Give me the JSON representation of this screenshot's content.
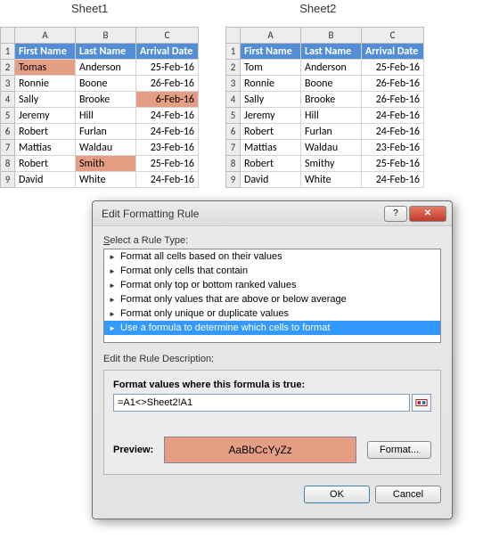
{
  "sheets": {
    "s1": {
      "label": "Sheet1"
    },
    "s2": {
      "label": "Sheet2"
    }
  },
  "cols": {
    "A": "A",
    "B": "B",
    "C": "C"
  },
  "hdr": {
    "fn": "First Name",
    "ln": "Last Name",
    "ad": "Arrival Date"
  },
  "d1": [
    {
      "n": "2",
      "fn": "Tomas",
      "ln": "Anderson",
      "ad": "25-Feb-16"
    },
    {
      "n": "3",
      "fn": "Ronnie",
      "ln": "Boone",
      "ad": "26-Feb-16"
    },
    {
      "n": "4",
      "fn": "Sally",
      "ln": "Brooke",
      "ad": "6-Feb-16"
    },
    {
      "n": "5",
      "fn": "Jeremy",
      "ln": "Hill",
      "ad": "24-Feb-16"
    },
    {
      "n": "6",
      "fn": "Robert",
      "ln": "Furlan",
      "ad": "24-Feb-16"
    },
    {
      "n": "7",
      "fn": "Mattias",
      "ln": "Waldau",
      "ad": "23-Feb-16"
    },
    {
      "n": "8",
      "fn": "Robert",
      "ln": "Smith",
      "ad": "25-Feb-16"
    },
    {
      "n": "9",
      "fn": "David",
      "ln": "White",
      "ad": "24-Feb-16"
    }
  ],
  "d2": [
    {
      "n": "2",
      "fn": "Tom",
      "ln": "Anderson",
      "ad": "25-Feb-16"
    },
    {
      "n": "3",
      "fn": "Ronnie",
      "ln": "Boone",
      "ad": "26-Feb-16"
    },
    {
      "n": "4",
      "fn": "Sally",
      "ln": "Brooke",
      "ad": "26-Feb-16"
    },
    {
      "n": "5",
      "fn": "Jeremy",
      "ln": "Hill",
      "ad": "24-Feb-16"
    },
    {
      "n": "6",
      "fn": "Robert",
      "ln": "Furlan",
      "ad": "24-Feb-16"
    },
    {
      "n": "7",
      "fn": "Mattias",
      "ln": "Waldau",
      "ad": "23-Feb-16"
    },
    {
      "n": "8",
      "fn": "Robert",
      "ln": "Smithy",
      "ad": "25-Feb-16"
    },
    {
      "n": "9",
      "fn": "David",
      "ln": "White",
      "ad": "24-Feb-16"
    }
  ],
  "row1": "1",
  "dialog": {
    "title": "Edit Formatting Rule",
    "select_label_pre": "S",
    "select_label_rest": "elect a Rule Type:",
    "rules": {
      "r0": "Format all cells based on their values",
      "r1": "Format only cells that contain",
      "r2": "Format only top or bottom ranked values",
      "r3": "Format only values that are above or below average",
      "r4": "Format only unique or duplicate values",
      "r5": "Use a formula to determine which cells to format"
    },
    "desc_label": "Edit the Rule Description:",
    "formula_label_pre": "Format values where this formula is true",
    "formula_label_suf": ":",
    "formula": "=A1<>Sheet2!A1",
    "preview_label": "Preview:",
    "preview_text": "AaBbCcYyZz",
    "format_btn": "Format...",
    "ok": "OK",
    "cancel": "Cancel",
    "help": "?",
    "close": "✕"
  }
}
